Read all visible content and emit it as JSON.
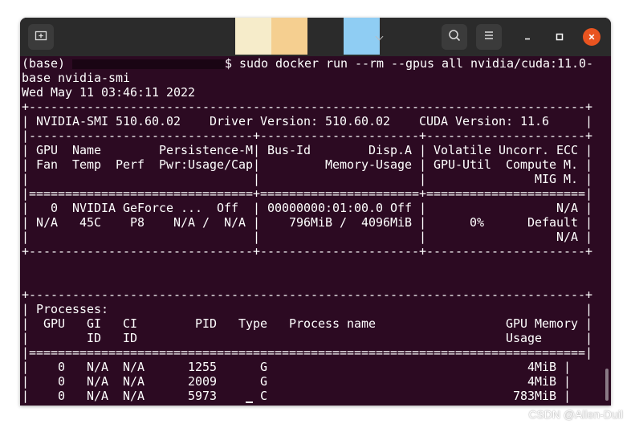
{
  "window": {
    "colors": {
      "terminal_bg": "#2c0a22",
      "headerbar_bg": "#2b2b2b",
      "close": "#e95420"
    },
    "new_tab_icon": "new-tab-icon",
    "search_icon": "search-icon",
    "menu_icon": "hamburger-menu-icon",
    "minimize_icon": "minimize-icon",
    "maximize_icon": "maximize-icon",
    "close_icon": "close-icon"
  },
  "terminal": {
    "prompt_prefix": "(base) ",
    "command_line": "$ sudo docker run --rm --gpus all nvidia/cuda:11.0-",
    "command_wrap": "base nvidia-smi",
    "lines": [
      "Wed May 11 03:46:11 2022",
      "+-----------------------------------------------------------------------------+",
      "| NVIDIA-SMI 510.60.02    Driver Version: 510.60.02    CUDA Version: 11.6     |",
      "|-------------------------------+----------------------+----------------------+",
      "| GPU  Name        Persistence-M| Bus-Id        Disp.A | Volatile Uncorr. ECC |",
      "| Fan  Temp  Perf  Pwr:Usage/Cap|         Memory-Usage | GPU-Util  Compute M. |",
      "|                               |                      |               MIG M. |",
      "|===============================+======================+======================|",
      "|   0  NVIDIA GeForce ...  Off  | 00000000:01:00.0 Off |                  N/A |",
      "| N/A   45C    P8    N/A /  N/A |    796MiB /  4096MiB |      0%      Default |",
      "|                               |                      |                  N/A |",
      "+-------------------------------+----------------------+----------------------+",
      "",
      "",
      "+-----------------------------------------------------------------------------+",
      "| Processes:                                                                  |",
      "|  GPU   GI   CI        PID   Type   Process name                  GPU Memory |",
      "|        ID   ID                                                   Usage      |",
      "|=============================================================================|",
      "|    0   N/A  N/A      1255      G                                    4MiB |",
      "|    0   N/A  N/A      2009      G                                    4MiB |",
      "|    0   N/A  N/A      5973      C                                  783MiB |",
      "+-----------------------------------------------------------------------------+"
    ]
  },
  "watermark": "CSDN @Allen-Duil"
}
